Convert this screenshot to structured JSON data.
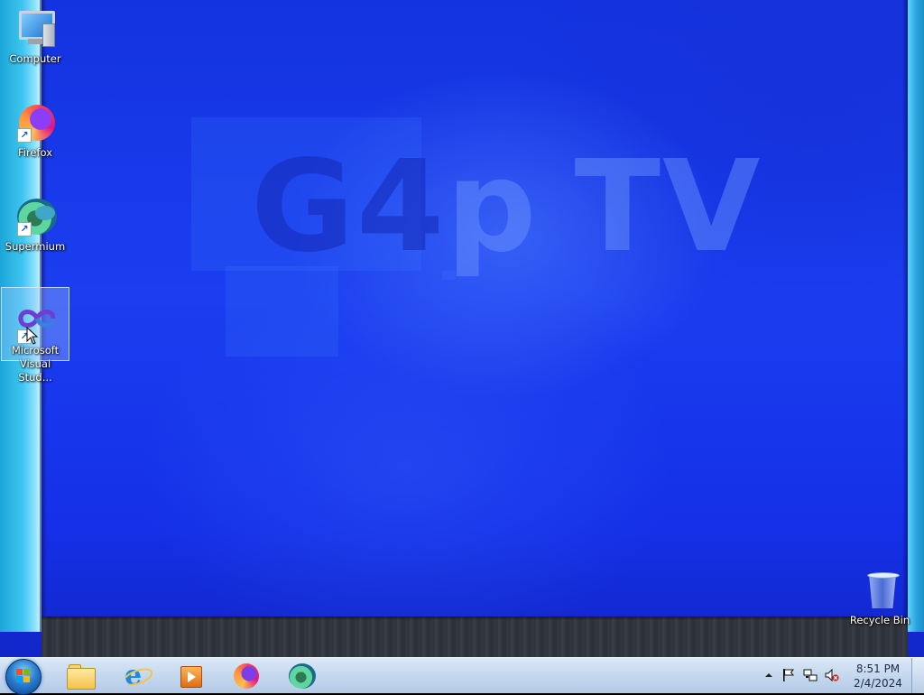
{
  "wallpaper": {
    "watermark": "G4p TV",
    "watermark_parts": {
      "left": "G4",
      "mid": "p",
      "right": "TV"
    },
    "base_color": "#1a3ef0"
  },
  "desktop_icons": [
    {
      "label": "Computer",
      "icon": "computer-icon",
      "shortcut": false,
      "selected": false
    },
    {
      "label": "Firefox",
      "icon": "firefox-icon",
      "shortcut": true,
      "selected": false
    },
    {
      "label": "Supermium",
      "icon": "supermium-icon",
      "shortcut": true,
      "selected": false
    },
    {
      "label": "Microsoft Visual Stud...",
      "icon": "visual-studio-icon",
      "shortcut": true,
      "selected": true
    },
    {
      "label": "Recycle Bin",
      "icon": "recycle-bin-icon",
      "shortcut": false,
      "selected": false
    }
  ],
  "taskbar": {
    "start": {
      "icon": "windows-start-icon"
    },
    "pinned": [
      {
        "icon": "file-explorer-icon"
      },
      {
        "icon": "internet-explorer-icon"
      },
      {
        "icon": "media-player-icon"
      },
      {
        "icon": "firefox-icon"
      },
      {
        "icon": "supermium-icon"
      }
    ],
    "tray": {
      "icons": [
        "show-hidden-icons-arrow",
        "action-center-flag-icon",
        "network-icon",
        "volume-muted-icon"
      ],
      "time": "8:51 PM",
      "date": "2/4/2024"
    }
  },
  "colors": {
    "taskbar_top": "#dce9f7",
    "taskbar_bottom": "#b4cbe6",
    "accent_cyan": "#3fc6f0"
  }
}
